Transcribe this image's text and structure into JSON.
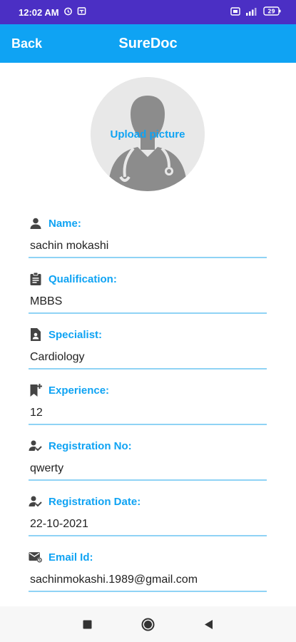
{
  "status_bar": {
    "time": "12:02 AM",
    "battery": "29"
  },
  "app_bar": {
    "back_label": "Back",
    "title": "SureDoc"
  },
  "profile": {
    "upload_label": "Upload picture"
  },
  "fields": [
    {
      "label": "Name:",
      "value": "sachin mokashi",
      "icon": "person-icon"
    },
    {
      "label": "Qualification:",
      "value": "MBBS",
      "icon": "clipboard-icon"
    },
    {
      "label": "Specialist:",
      "value": "Cardiology",
      "icon": "id-card-icon"
    },
    {
      "label": "Experience:",
      "value": "12",
      "icon": "bookmark-add-icon"
    },
    {
      "label": "Registration No:",
      "value": "qwerty",
      "icon": "person-check-icon"
    },
    {
      "label": "Registration Date:",
      "value": "22-10-2021",
      "icon": "person-check-icon"
    },
    {
      "label": "Email Id:",
      "value": "sachinmokashi.1989@gmail.com",
      "icon": "mail-icon"
    }
  ],
  "colors": {
    "status_bar": "#4B2FC4",
    "app_bar": "#0FA3F3",
    "accent": "#0FA3F3",
    "underline": "#8fd3f5"
  }
}
